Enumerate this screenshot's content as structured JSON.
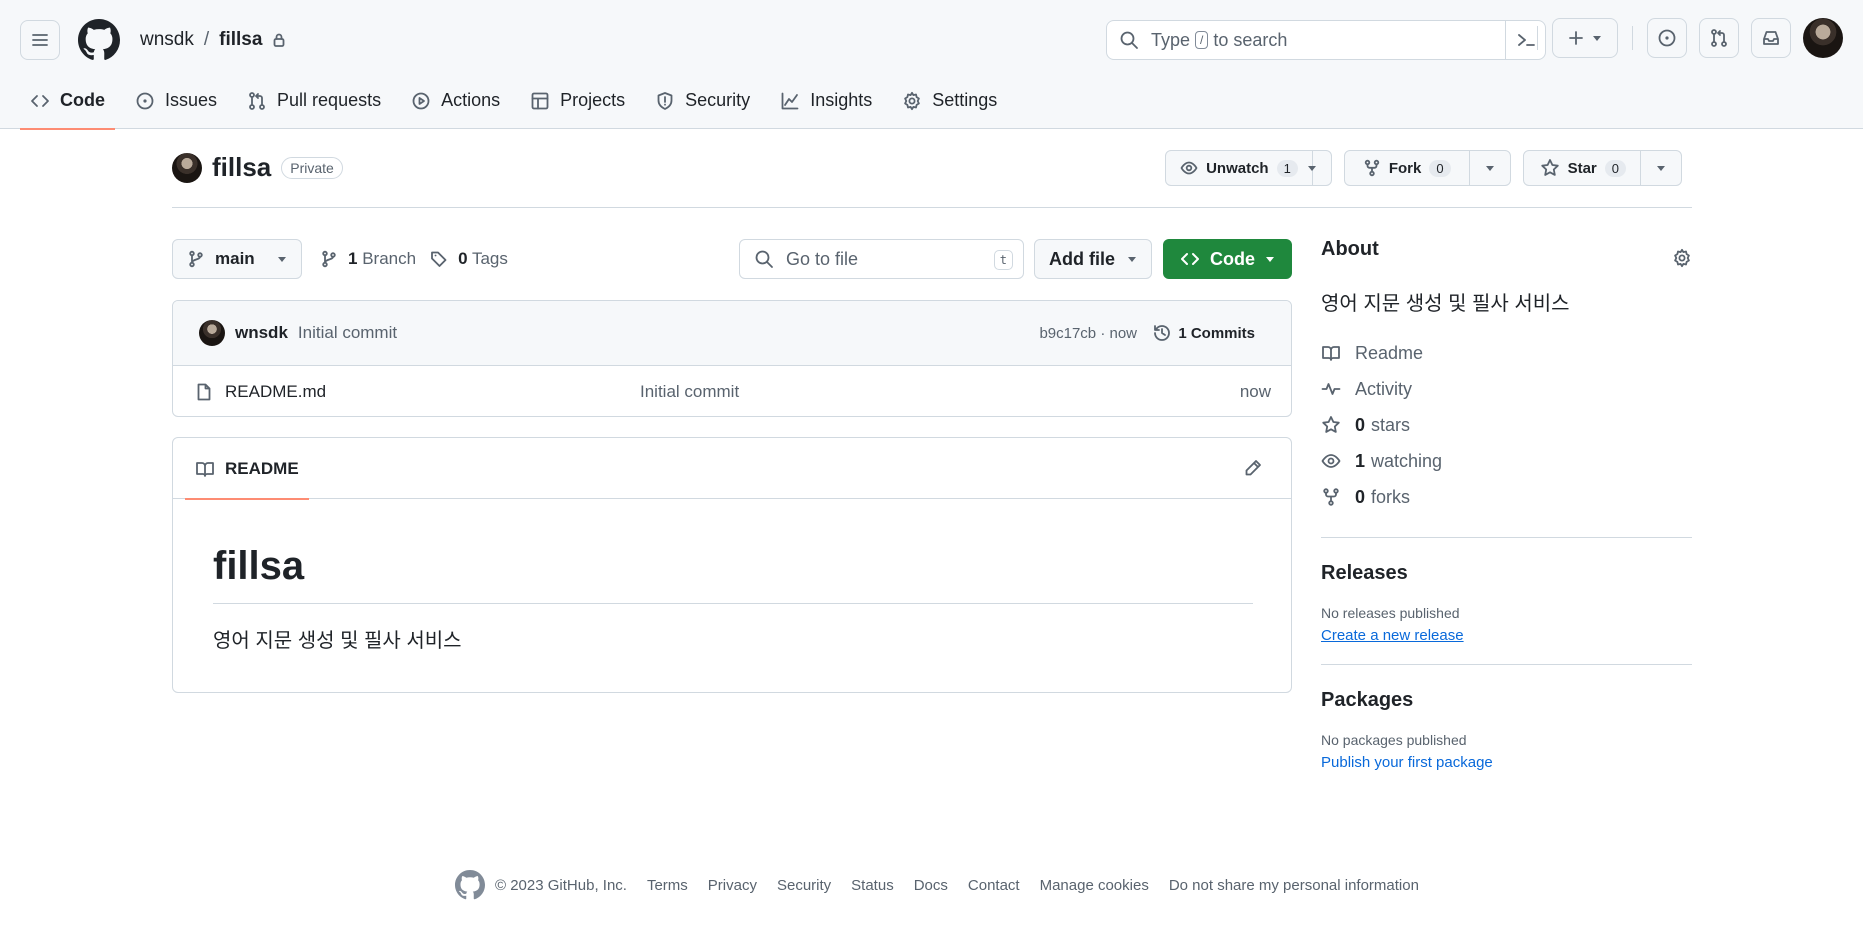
{
  "header": {
    "owner": "wnsdk",
    "separator": "/",
    "repo": "fillsa",
    "search_pre": "Type",
    "search_key": "/",
    "search_post": "to search"
  },
  "tabs": [
    {
      "label": "Code",
      "icon": "code-icon"
    },
    {
      "label": "Issues",
      "icon": "issue-icon"
    },
    {
      "label": "Pull requests",
      "icon": "pull-request-icon"
    },
    {
      "label": "Actions",
      "icon": "play-icon"
    },
    {
      "label": "Projects",
      "icon": "table-icon"
    },
    {
      "label": "Security",
      "icon": "shield-icon"
    },
    {
      "label": "Insights",
      "icon": "graph-icon"
    },
    {
      "label": "Settings",
      "icon": "gear-icon"
    }
  ],
  "repo_head": {
    "title": "fillsa",
    "visibility": "Private",
    "unwatch_label": "Unwatch",
    "watch_count": "1",
    "fork_label": "Fork",
    "fork_count": "0",
    "star_label": "Star",
    "star_count": "0"
  },
  "toolbar": {
    "branch": "main",
    "branch_count": "1",
    "branch_label": "Branch",
    "tag_count": "0",
    "tag_label": "Tags",
    "goto_placeholder": "Go to file",
    "goto_key": "t",
    "add_file": "Add file",
    "code": "Code"
  },
  "commit": {
    "user": "wnsdk",
    "message": "Initial commit",
    "sha_time": "b9c17cb · now",
    "commits": "1 Commits"
  },
  "files": [
    {
      "name": "README.md",
      "message": "Initial commit",
      "age": "now"
    }
  ],
  "readme": {
    "tab": "README",
    "heading": "fillsa",
    "body": "영어 지문 생성 및 필사 서비스"
  },
  "about": {
    "title": "About",
    "description": "영어 지문 생성 및 필사 서비스",
    "readme": "Readme",
    "activity": "Activity",
    "stars_count": "0",
    "stars_label": "stars",
    "watching_count": "1",
    "watching_label": "watching",
    "forks_count": "0",
    "forks_label": "forks"
  },
  "releases": {
    "title": "Releases",
    "none": "No releases published",
    "link": "Create a new release"
  },
  "packages": {
    "title": "Packages",
    "none": "No packages published",
    "link": "Publish your first package"
  },
  "footer": {
    "copyright": "© 2023 GitHub, Inc.",
    "links": [
      "Terms",
      "Privacy",
      "Security",
      "Status",
      "Docs",
      "Contact",
      "Manage cookies",
      "Do not share my personal information"
    ]
  },
  "colors": {
    "accent_underline": "#fd8c73",
    "primary_button": "#1f883d",
    "link": "#0969da"
  }
}
